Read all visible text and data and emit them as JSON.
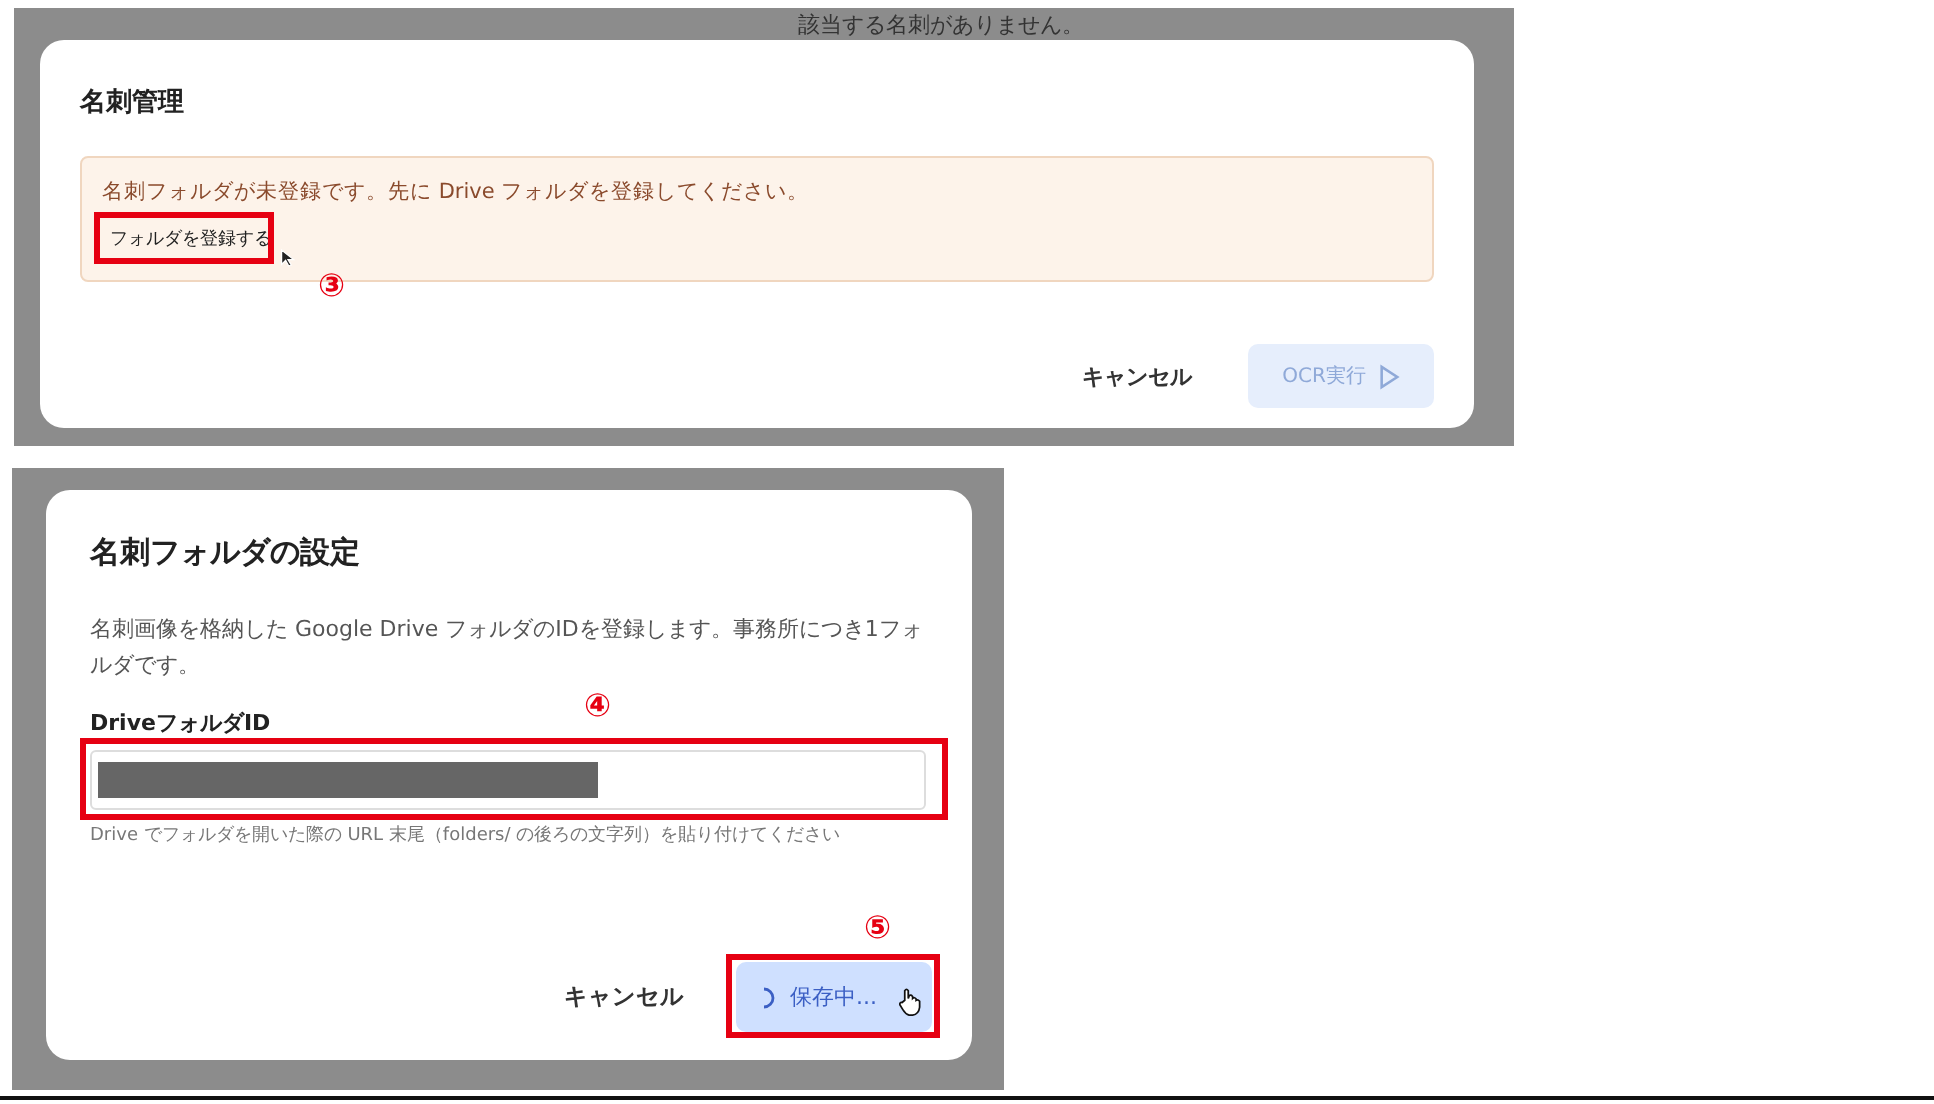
{
  "panels": [
    {
      "kind": "alert",
      "backdrop_text": "該当する名刺がありません。",
      "title": "名刺管理",
      "alert": {
        "message": "名刺フォルダが未登録です。先に Drive フォルダを登録してください。",
        "button": "フォルダを登録する",
        "step": "③"
      },
      "buttons": [
        {
          "kind": "text",
          "label": "キャンセル"
        },
        {
          "kind": "run",
          "label": "OCR実行",
          "disabled": true
        }
      ]
    },
    {
      "kind": "form",
      "title": "名刺フォルダの設定",
      "description": "名刺画像を格納した Google Drive フォルダのIDを登録します。事務所につき1フォルダです。",
      "field": {
        "label": "DriveフォルダID",
        "redacted": true,
        "step": "④",
        "hint": "Drive でフォルダを開いた際の URL 末尾（folders/ の後ろの文字列）を貼り付けてください"
      },
      "buttons": [
        {
          "kind": "text",
          "label": "キャンセル"
        },
        {
          "kind": "save",
          "label": "保存中...",
          "loading": true,
          "step": "⑤"
        }
      ]
    }
  ]
}
